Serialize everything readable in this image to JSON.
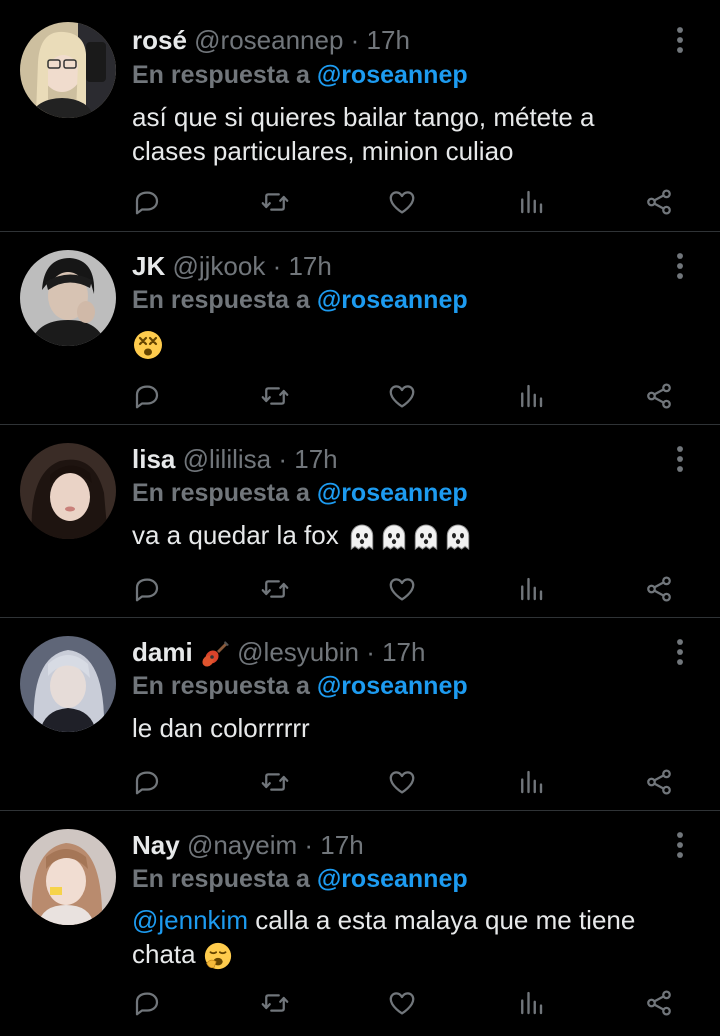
{
  "tweets": [
    {
      "name": "rosé",
      "handle": "@roseannep",
      "time": "· 17h",
      "reply_prefix": "En respuesta a",
      "reply_to": "@roseannep",
      "text_lines": [
        "así que si quieres bailar tango, métete a",
        "clases particulares, minion culiao"
      ],
      "avatar_color": "#cdbf9f"
    },
    {
      "name": "JK",
      "handle": "@jjkook",
      "time": "· 17h",
      "reply_prefix": "En respuesta a",
      "reply_to": "@roseannep",
      "text_lines": [],
      "avatar_color": "#3a3a3a"
    },
    {
      "name": "lisa",
      "handle": "@lililisa",
      "time": "· 17h",
      "reply_prefix": "En respuesta a",
      "reply_to": "@roseannep",
      "text_lines": [
        "va a quedar la fox"
      ],
      "avatar_color": "#4b3b33"
    },
    {
      "name": "dami",
      "handle": "@lesyubin",
      "time": "· 17h",
      "reply_prefix": "En respuesta a",
      "reply_to": "@roseannep",
      "text_lines": [
        "le dan colorrrrrr"
      ],
      "avatar_color": "#8f95a8"
    },
    {
      "name": "Nay",
      "handle": "@nayeim",
      "time": "· 17h",
      "reply_prefix": "En respuesta a",
      "reply_to": "@roseannep",
      "mention": "@jennkim",
      "text_lines": [
        " calla a esta malaya que me tiene",
        "chata"
      ],
      "avatar_color": "#d8bfb4"
    }
  ],
  "colors": {
    "background": "#000000",
    "text": "#e7e9ea",
    "muted": "#71767b",
    "accent": "#1d9bf0",
    "divider": "#2f3336"
  },
  "icons": [
    "reply-icon",
    "retweet-icon",
    "like-icon",
    "analytics-icon",
    "share-icon",
    "more-icon"
  ]
}
